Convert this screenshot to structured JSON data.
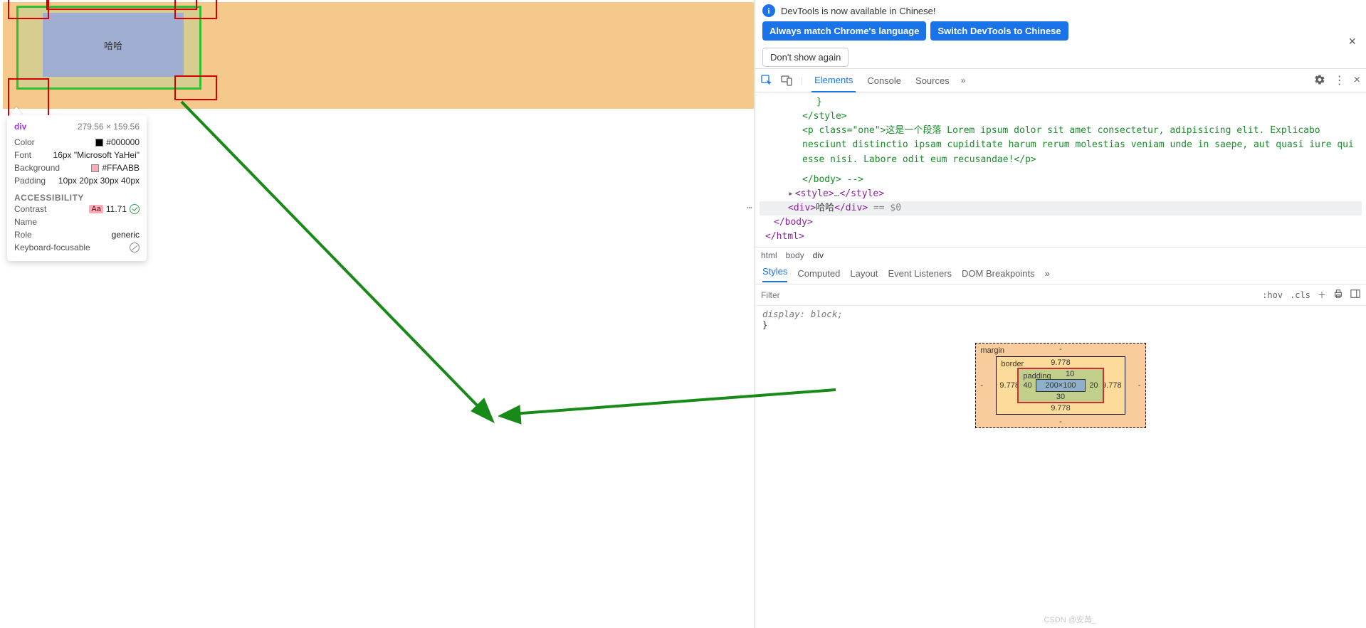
{
  "inspected": {
    "text": "哈哈",
    "tag": "div",
    "dim": "279.56 × 159.56",
    "color_hex": "#000000",
    "font": "16px \"Microsoft YaHei\"",
    "background_hex": "#FFAABB",
    "padding": "10px 20px 30px 40px",
    "labels": {
      "color": "Color",
      "font": "Font",
      "background": "Background",
      "padding": "Padding"
    },
    "a11y": {
      "title": "ACCESSIBILITY",
      "contrast_label": "Contrast",
      "contrast_aa": "Aa",
      "contrast_value": "11.71",
      "name_label": "Name",
      "role_label": "Role",
      "role_value": "generic",
      "kf_label": "Keyboard-focusable"
    }
  },
  "langbar": {
    "info_text": "DevTools is now available in Chinese!",
    "btn_match": "Always match Chrome's language",
    "btn_switch": "Switch DevTools to Chinese",
    "btn_dont": "Don't show again"
  },
  "tabs_top": {
    "elements": "Elements",
    "console": "Console",
    "sources": "Sources"
  },
  "dom": {
    "brace": "}",
    "close_style": "</style>",
    "p_open": "<p class=\"one\">",
    "p_text": "这是一个段落 Lorem ipsum dolor sit amet consectetur, adipisicing elit. Explicabo nesciunt distinctio ipsam cupiditate harum rerum molestias veniam unde in saepe, aut quasi iure qui esse nisi. Labore odit eum recusandae!",
    "p_close": "</p>",
    "close_body_comment": "</body> -->",
    "style_fold": "<style>…</style>",
    "sel_open": "<div>",
    "sel_text": "哈哈",
    "sel_close": "</div>",
    "sel_suffix": "== $0",
    "close_body": "</body>",
    "close_html": "</html>",
    "ellipsis": "⋯"
  },
  "breadcrumb": {
    "html": "html",
    "body": "body",
    "div": "div"
  },
  "styles_tabs": {
    "styles": "Styles",
    "computed": "Computed",
    "layout": "Layout",
    "listeners": "Event Listeners",
    "dombp": "DOM Breakpoints"
  },
  "filter": {
    "placeholder": "Filter",
    "hov": ":hov",
    "cls": ".cls"
  },
  "style_rule": {
    "line": "display: block;",
    "close": "}"
  },
  "box": {
    "margin": "margin",
    "border": "border",
    "padding": "padding",
    "content": "200×100",
    "m": {
      "top": "-",
      "right": "-",
      "bottom": "-",
      "left": "-"
    },
    "b": {
      "top": "9.778",
      "right": "9.778",
      "bottom": "9.778",
      "left": "9.778"
    },
    "p": {
      "top": "10",
      "right": "20",
      "bottom": "30",
      "left": "40"
    }
  },
  "watermark": "CSDN @安苒_"
}
